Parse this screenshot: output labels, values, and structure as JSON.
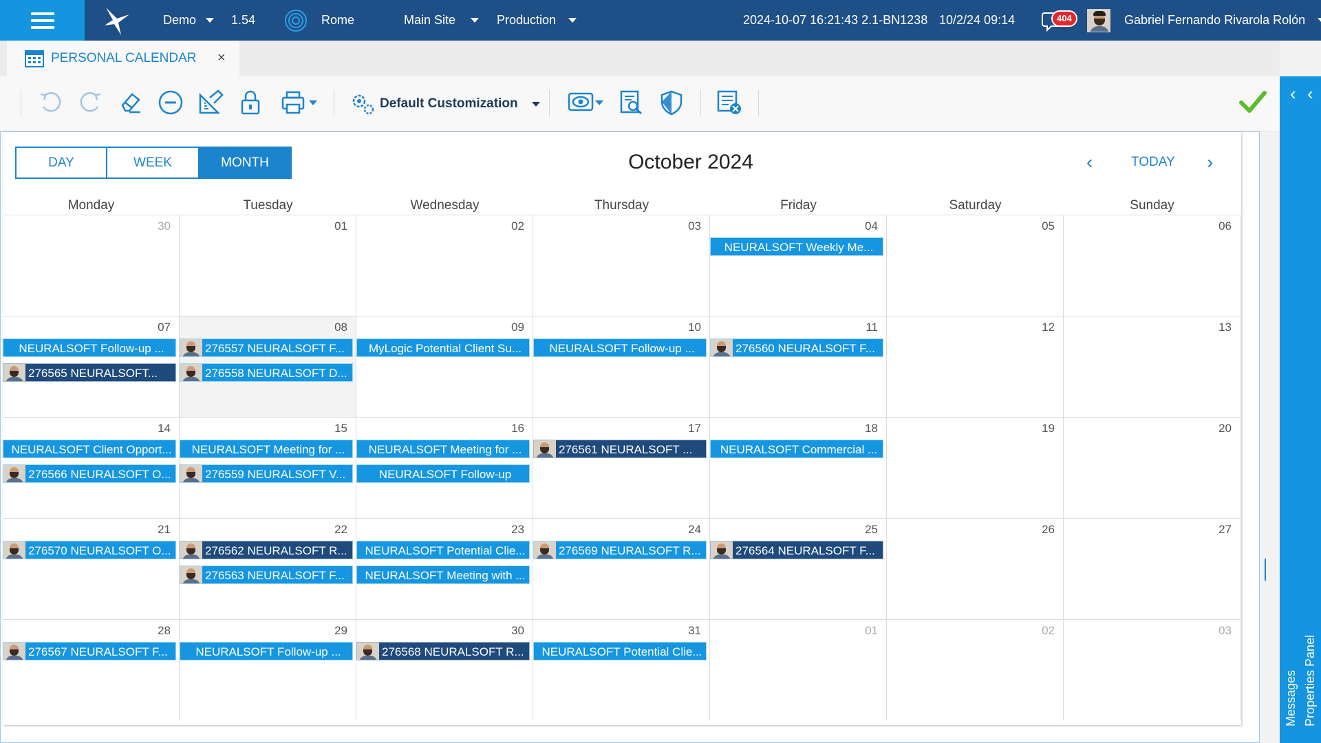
{
  "topbar": {
    "company": "Demo",
    "version": "1.54",
    "city": "Rome",
    "site": "Main Site",
    "environment": "Production",
    "build_info": "2024-10-07 16:21:43 2.1-BN1238",
    "date_time": "10/2/24 09:14",
    "notification_count": "404",
    "user_name": "Gabriel Fernando Rivarola Rolón"
  },
  "tab": {
    "label": "PERSONAL CALENDAR",
    "close": "×"
  },
  "toolbar": {
    "customization_label": "Default Customization"
  },
  "right_panel": {
    "messages": "Messages",
    "properties": "Properties Panel",
    "collapse_glyph": "‹"
  },
  "calendar": {
    "views": [
      "DAY",
      "WEEK",
      "MONTH"
    ],
    "active_view": "MONTH",
    "title": "October 2024",
    "today_label": "TODAY",
    "prev_glyph": "‹",
    "next_glyph": "›",
    "weekdays": [
      "Monday",
      "Tuesday",
      "Wednesday",
      "Thursday",
      "Friday",
      "Saturday",
      "Sunday"
    ],
    "weeks": [
      [
        {
          "day": "30",
          "other": true,
          "events": []
        },
        {
          "day": "01",
          "events": []
        },
        {
          "day": "02",
          "events": []
        },
        {
          "day": "03",
          "events": []
        },
        {
          "day": "04",
          "events": [
            {
              "text": "NEURALSOFT Weekly Me...",
              "style": "light",
              "avatar": false
            }
          ]
        },
        {
          "day": "05",
          "events": []
        },
        {
          "day": "06",
          "events": []
        }
      ],
      [
        {
          "day": "07",
          "events": [
            {
              "text": "NEURALSOFT Follow-up ...",
              "style": "light",
              "avatar": false
            },
            {
              "text": "276565 NEURALSOFT...",
              "style": "dark",
              "avatar": true
            }
          ]
        },
        {
          "day": "08",
          "shade": true,
          "events": [
            {
              "text": "276557 NEURALSOFT F...",
              "style": "light",
              "avatar": true
            },
            {
              "text": "276558 NEURALSOFT D...",
              "style": "light",
              "avatar": true
            }
          ]
        },
        {
          "day": "09",
          "events": [
            {
              "text": "MyLogic Potential Client Su...",
              "style": "light",
              "avatar": false
            }
          ]
        },
        {
          "day": "10",
          "events": [
            {
              "text": "NEURALSOFT Follow-up ...",
              "style": "light",
              "avatar": false
            }
          ]
        },
        {
          "day": "11",
          "events": [
            {
              "text": "276560 NEURALSOFT F...",
              "style": "light",
              "avatar": true
            }
          ]
        },
        {
          "day": "12",
          "events": []
        },
        {
          "day": "13",
          "events": []
        }
      ],
      [
        {
          "day": "14",
          "events": [
            {
              "text": "NEURALSOFT Client Opport...",
              "style": "light",
              "avatar": false
            },
            {
              "text": "276566 NEURALSOFT O...",
              "style": "light",
              "avatar": true
            }
          ]
        },
        {
          "day": "15",
          "events": [
            {
              "text": "NEURALSOFT Meeting for ...",
              "style": "light",
              "avatar": false
            },
            {
              "text": "276559 NEURALSOFT V...",
              "style": "light",
              "avatar": true
            }
          ]
        },
        {
          "day": "16",
          "events": [
            {
              "text": "NEURALSOFT Meeting for ...",
              "style": "light",
              "avatar": false
            },
            {
              "text": "NEURALSOFT Follow-up",
              "style": "light",
              "avatar": false
            }
          ]
        },
        {
          "day": "17",
          "events": [
            {
              "text": "276561 NEURALSOFT ...",
              "style": "dark",
              "avatar": true
            }
          ]
        },
        {
          "day": "18",
          "events": [
            {
              "text": "NEURALSOFT Commercial ...",
              "style": "light",
              "avatar": false
            }
          ]
        },
        {
          "day": "19",
          "events": []
        },
        {
          "day": "20",
          "events": []
        }
      ],
      [
        {
          "day": "21",
          "events": [
            {
              "text": "276570 NEURALSOFT O...",
              "style": "light",
              "avatar": true
            }
          ]
        },
        {
          "day": "22",
          "events": [
            {
              "text": "276562 NEURALSOFT R...",
              "style": "dark",
              "avatar": true
            },
            {
              "text": "276563 NEURALSOFT F...",
              "style": "light",
              "avatar": true
            }
          ]
        },
        {
          "day": "23",
          "events": [
            {
              "text": "NEURALSOFT Potential Clie...",
              "style": "light",
              "avatar": false
            },
            {
              "text": "NEURALSOFT Meeting with ...",
              "style": "light",
              "avatar": false
            }
          ]
        },
        {
          "day": "24",
          "events": [
            {
              "text": "276569 NEURALSOFT R...",
              "style": "light",
              "avatar": true
            }
          ]
        },
        {
          "day": "25",
          "events": [
            {
              "text": "276564 NEURALSOFT F...",
              "style": "dark",
              "avatar": true
            }
          ]
        },
        {
          "day": "26",
          "events": []
        },
        {
          "day": "27",
          "events": []
        }
      ],
      [
        {
          "day": "28",
          "events": [
            {
              "text": "276567 NEURALSOFT F...",
              "style": "light",
              "avatar": true
            }
          ]
        },
        {
          "day": "29",
          "events": [
            {
              "text": "NEURALSOFT Follow-up ...",
              "style": "light",
              "avatar": false
            }
          ]
        },
        {
          "day": "30",
          "events": [
            {
              "text": "276568 NEURALSOFT R...",
              "style": "dark",
              "avatar": true
            }
          ]
        },
        {
          "day": "31",
          "events": [
            {
              "text": "NEURALSOFT Potential Clie...",
              "style": "light",
              "avatar": false
            }
          ]
        },
        {
          "day": "01",
          "other": true,
          "events": []
        },
        {
          "day": "02",
          "other": true,
          "events": []
        },
        {
          "day": "03",
          "other": true,
          "events": []
        }
      ]
    ]
  },
  "icons": [
    "menu-icon",
    "logo-bird-icon",
    "location-target-icon",
    "calendar-icon",
    "close-icon",
    "undo-icon",
    "redo-icon",
    "eraser-icon",
    "remove-circle-icon",
    "ruler-pencil-icon",
    "lock-icon",
    "print-icon",
    "settings-gears-icon",
    "eye-icon",
    "report-search-icon",
    "shield-icon",
    "list-delete-icon",
    "checkmark-icon",
    "notification-bell-icon",
    "avatar"
  ],
  "colors": {
    "topbar": "#1e4f86",
    "accent": "#1594df",
    "event_light": "#1696e0",
    "event_dark": "#1e4a7c",
    "badge": "#e5262a",
    "check": "#5cbb2e"
  }
}
